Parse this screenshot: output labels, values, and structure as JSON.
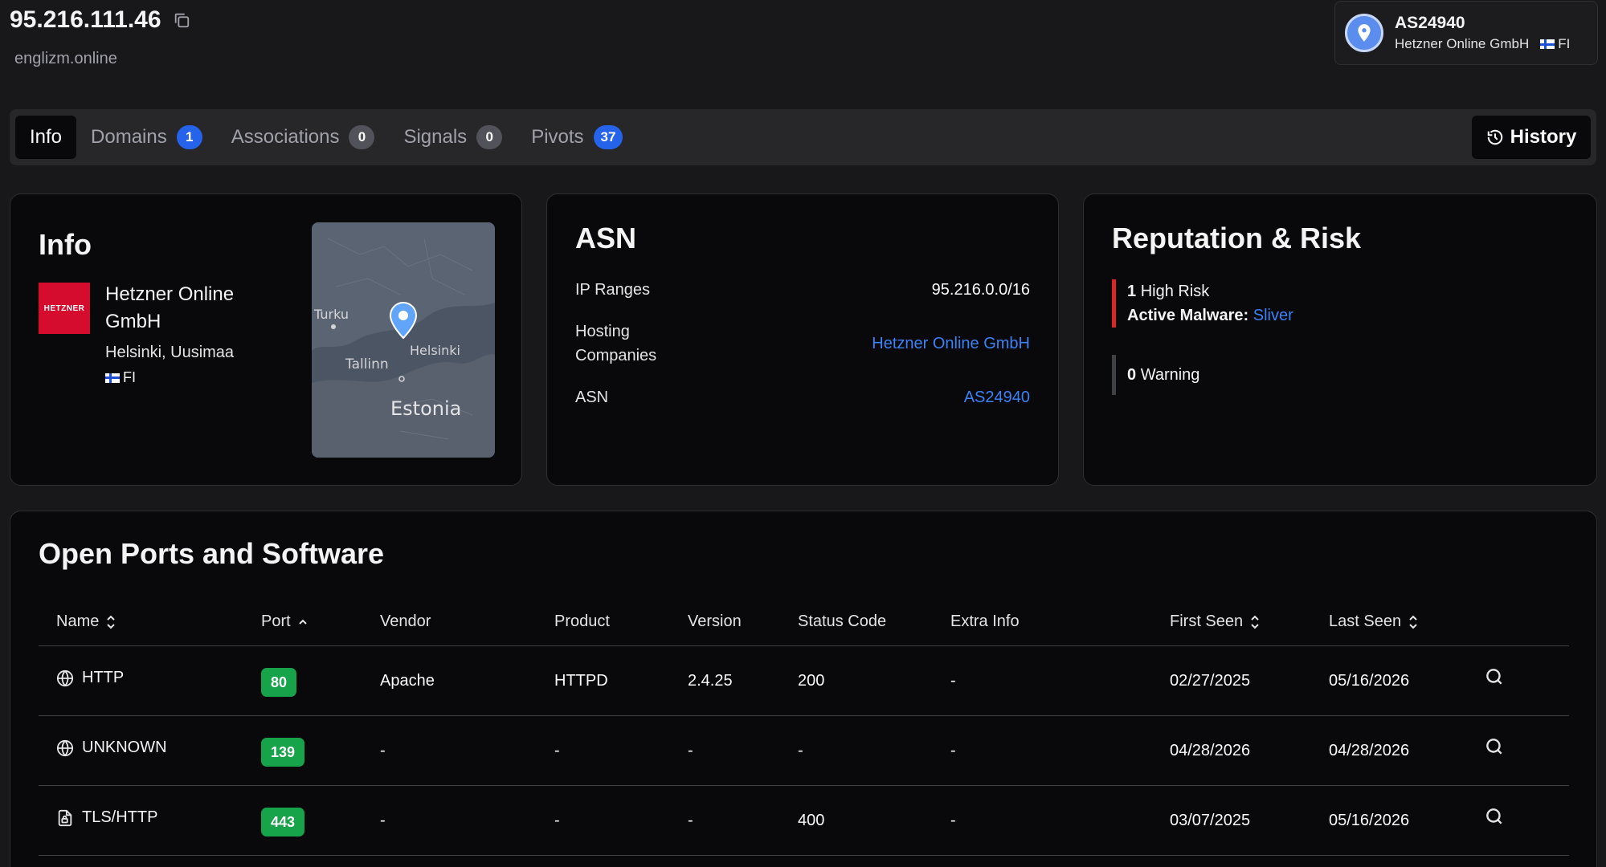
{
  "header": {
    "ip": "95.216.111.46",
    "hostname": "englizm.online"
  },
  "asn_badge": {
    "asn": "AS24940",
    "org": "Hetzner Online GmbH",
    "country": "FI"
  },
  "tabs": [
    {
      "label": "Info",
      "count": ""
    },
    {
      "label": "Domains",
      "count": "1"
    },
    {
      "label": "Associations",
      "count": "0"
    },
    {
      "label": "Signals",
      "count": "0"
    },
    {
      "label": "Pivots",
      "count": "37"
    }
  ],
  "history_label": "History",
  "info": {
    "title": "Info",
    "logo_text": "HETZNER",
    "company": "Hetzner Online GmbH",
    "location": "Helsinki, Uusimaa",
    "country": "FI",
    "map_labels": {
      "turku": "Turku",
      "helsinki": "Helsinki",
      "tallinn": "Tallinn",
      "estonia": "Estonia"
    }
  },
  "asn": {
    "title": "ASN",
    "ip_ranges_label": "IP Ranges",
    "ip_ranges_value": "95.216.0.0/16",
    "hosting_label": "Hosting Companies",
    "hosting_value": "Hetzner Online GmbH",
    "asn_label": "ASN",
    "asn_value": "AS24940"
  },
  "reputation": {
    "title": "Reputation & Risk",
    "high_risk_count": "1",
    "high_risk_label": "High Risk",
    "malware_label": "Active Malware:",
    "malware_value": "Sliver",
    "warning_count": "0",
    "warning_label": "Warning"
  },
  "ports": {
    "title": "Open Ports and Software",
    "columns": [
      "Name",
      "Port",
      "Vendor",
      "Product",
      "Version",
      "Status Code",
      "Extra Info",
      "First Seen",
      "Last Seen"
    ],
    "rows": [
      {
        "icon": "globe-icon",
        "name": "HTTP",
        "port": "80",
        "vendor": "Apache",
        "product": "HTTPD",
        "version": "2.4.25",
        "status": "200",
        "extra": "-",
        "first_seen": "02/27/2025",
        "last_seen": "05/16/2026"
      },
      {
        "icon": "globe-icon",
        "name": "UNKNOWN",
        "port": "139",
        "vendor": "-",
        "product": "-",
        "version": "-",
        "status": "-",
        "extra": "-",
        "first_seen": "04/28/2026",
        "last_seen": "04/28/2026"
      },
      {
        "icon": "lock-file-icon",
        "name": "TLS/HTTP",
        "port": "443",
        "vendor": "-",
        "product": "-",
        "version": "-",
        "status": "400",
        "extra": "-",
        "first_seen": "03/07/2025",
        "last_seen": "05/16/2026"
      }
    ]
  }
}
